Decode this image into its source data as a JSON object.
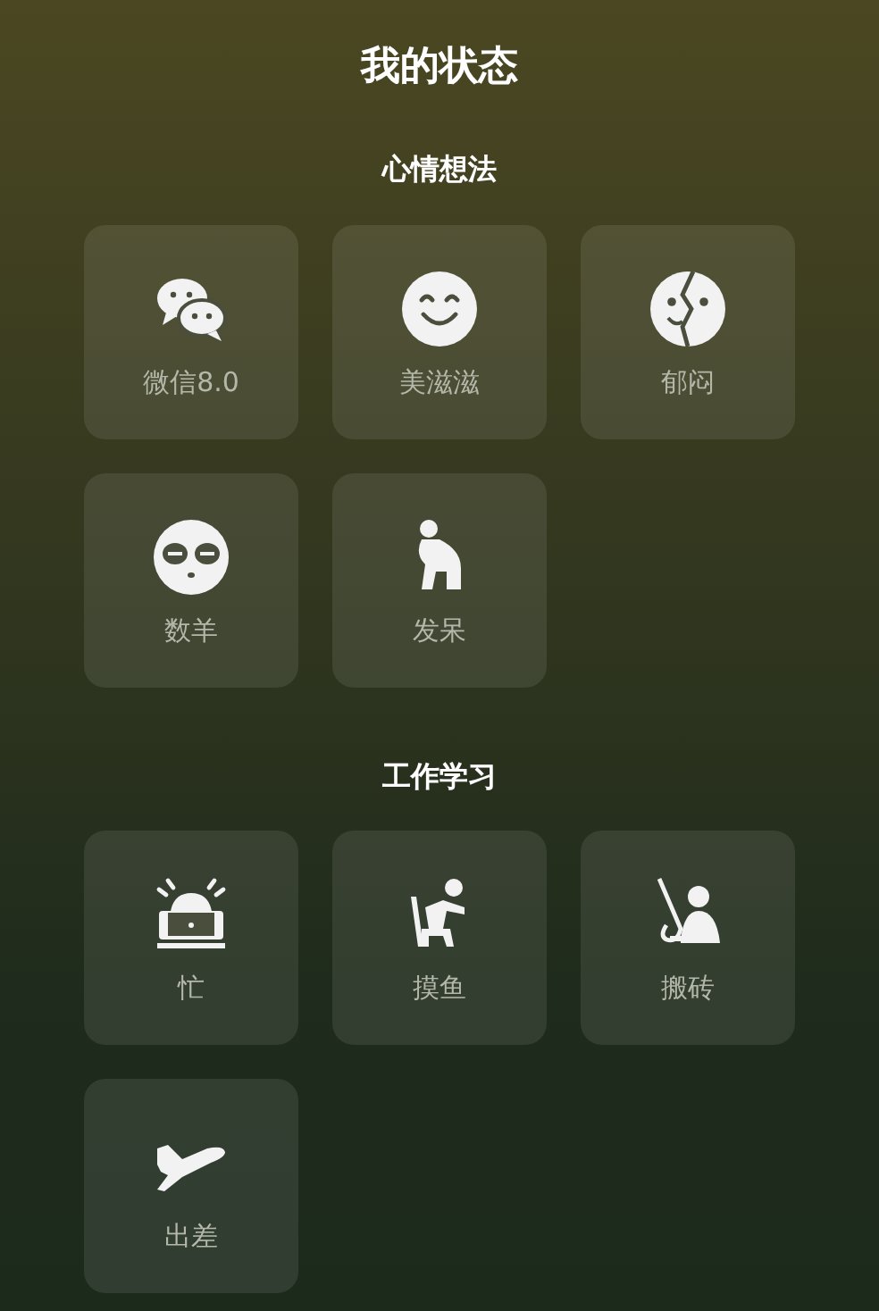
{
  "title": "我的状态",
  "sections": [
    {
      "heading": "心情想法",
      "items": [
        {
          "label": "微信8.0",
          "kind": "chat"
        },
        {
          "label": "美滋滋",
          "kind": "smile"
        },
        {
          "label": "郁闷",
          "kind": "split-face"
        },
        {
          "label": "数羊",
          "kind": "sleepy-face"
        },
        {
          "label": "发呆",
          "kind": "thinker"
        }
      ]
    },
    {
      "heading": "工作学习",
      "items": [
        {
          "label": "忙",
          "kind": "laptop-alarm"
        },
        {
          "label": "摸鱼",
          "kind": "sitting"
        },
        {
          "label": "搬砖",
          "kind": "shovel"
        },
        {
          "label": "出差",
          "kind": "plane"
        }
      ]
    }
  ]
}
